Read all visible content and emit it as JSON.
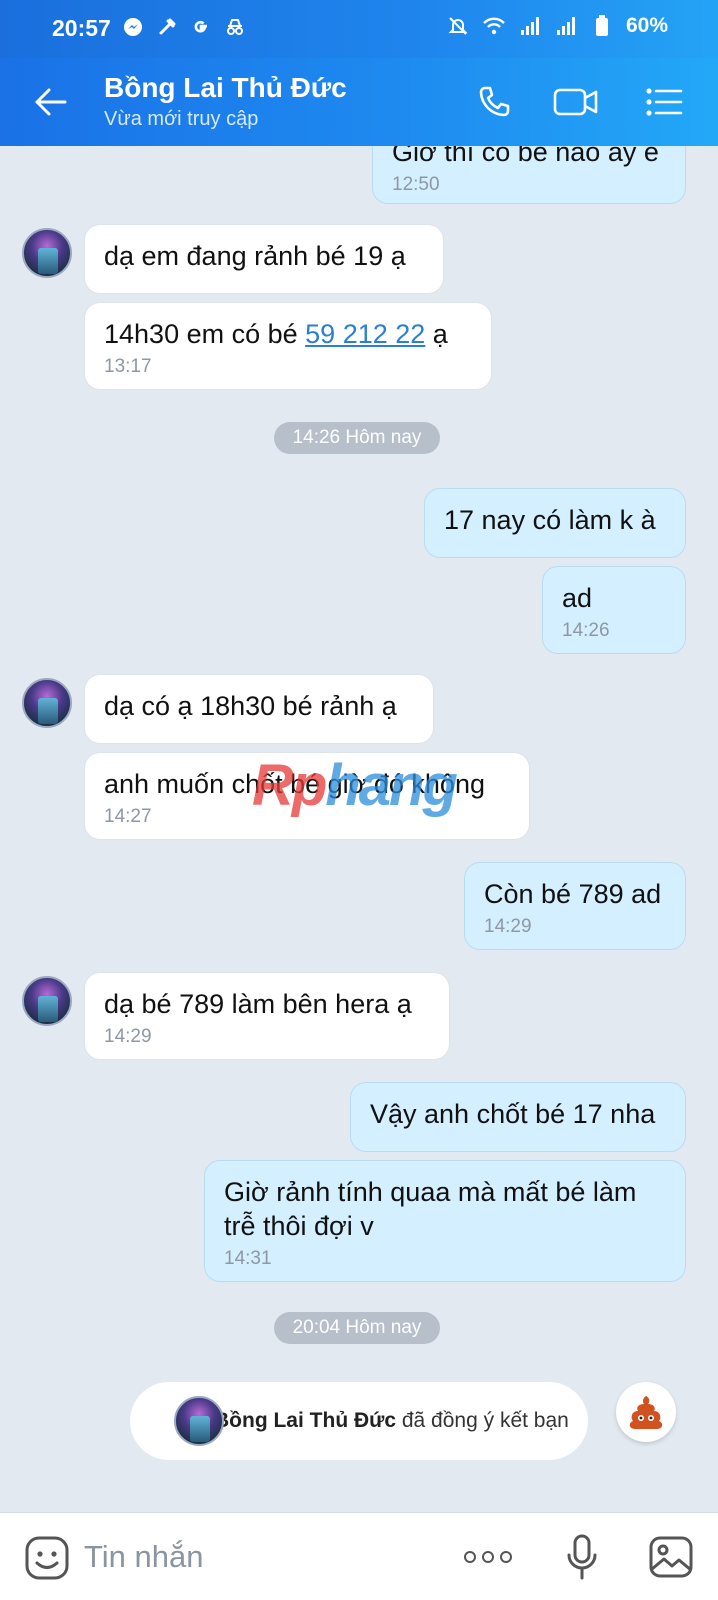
{
  "status_bar": {
    "time": "20:57",
    "left_icons": [
      "messenger-icon",
      "tools-icon",
      "google-icon",
      "incognito-icon"
    ],
    "right_icons": [
      "mute-icon",
      "wifi-icon",
      "signal-icon",
      "signal-icon",
      "battery-icon"
    ],
    "battery": "60%"
  },
  "header": {
    "title": "Bồng Lai Thủ Đức",
    "subtitle": "Vừa mới truy cập",
    "accent_color": "#1e8af0"
  },
  "messages": [
    {
      "side": "out",
      "text": "Giờ thì có bé nào ấy e",
      "time": "12:50"
    },
    {
      "side": "in",
      "text": "dạ em đang rảnh bé 19 ạ",
      "time": ""
    },
    {
      "side": "in",
      "text_before": "14h30 em có bé ",
      "link": "59 212 22",
      "text_after": " ạ",
      "time": "13:17"
    },
    {
      "side": "out",
      "text": "17 nay có làm k à",
      "time": ""
    },
    {
      "side": "out",
      "text": "ad",
      "time": "14:26"
    },
    {
      "side": "in",
      "text": "dạ có ạ 18h30 bé rảnh ạ",
      "time": ""
    },
    {
      "side": "in",
      "text": "anh muốn chốt bé giờ đó không",
      "time": "14:27"
    },
    {
      "side": "out",
      "text": "Còn bé 789 ad",
      "time": "14:29"
    },
    {
      "side": "in",
      "text": "dạ bé 789 làm bên hera ạ",
      "time": "14:29"
    },
    {
      "side": "out",
      "text": "Vậy anh chốt bé 17 nha",
      "time": ""
    },
    {
      "side": "out",
      "text": "Giờ rảnh tính quaa mà mất bé làm trễ thôi đợi v",
      "time": "14:31"
    }
  ],
  "date_separators": [
    "14:26 Hôm nay",
    "20:04 Hôm nay"
  ],
  "system_message": {
    "name": "Bồng Lai Thủ Đức",
    "text": " đã đồng ý kết bạn"
  },
  "watermark": {
    "part1": "Rp",
    "part2": "hang"
  },
  "composer": {
    "placeholder": "Tin nhắn"
  }
}
